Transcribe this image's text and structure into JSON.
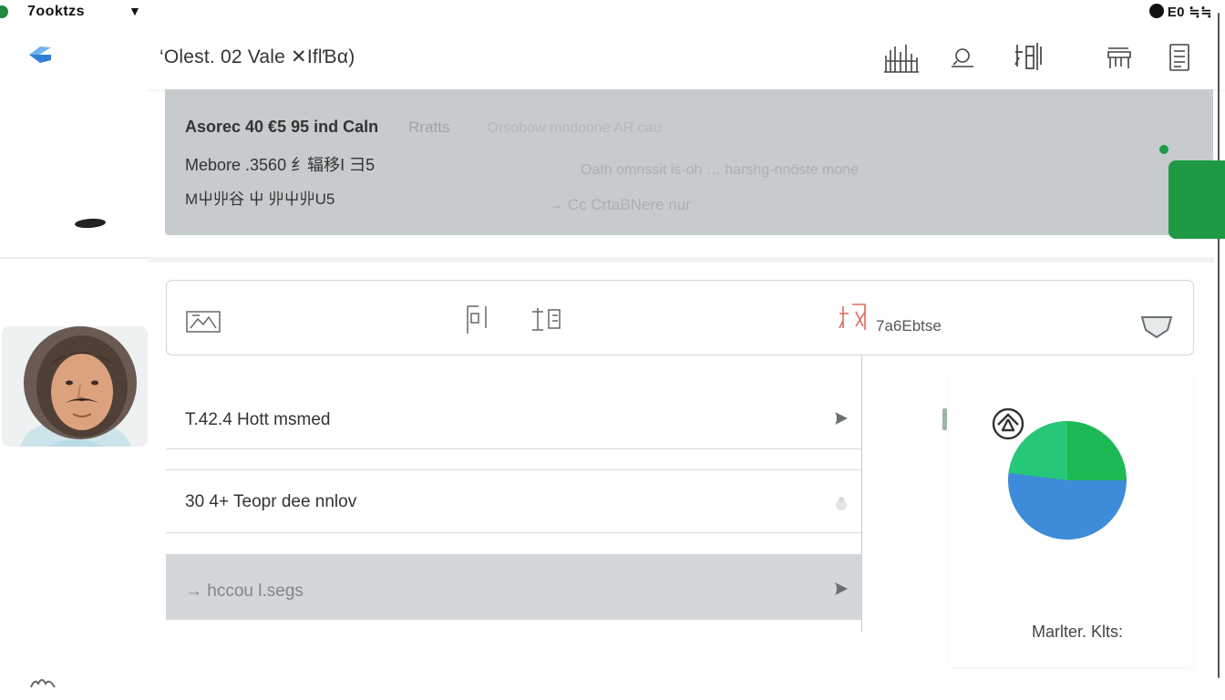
{
  "status_bar": {
    "app_name": "7ooktzs",
    "right_text": "E0 ≒≒"
  },
  "header": {
    "title": "‘Olest. 02 Vale ✕IflƁα)"
  },
  "summary": {
    "line1_bold": "Asorec 40 €5 95 ind Caln",
    "line1_faded": "Rratts",
    "line1_faded2": "Orsobow mndoone AR cau",
    "line2": "Mebore .3560 纟辐移I 彐5",
    "line2_faded": "Oath omnssit is-oh … harshg-nnöste mone",
    "line3": "Μ屮丱谷 屮 丱屮丱U5",
    "line3_faded": "→ Cc CrtaBNere nur"
  },
  "toolbar": {
    "status_text": "7a6Ebtse"
  },
  "list": {
    "rows": [
      {
        "label": "T.42.4 Hott msmed"
      },
      {
        "label": "30  4+ Teopr dee nnlov"
      },
      {
        "label": "→  hccou l.segs"
      }
    ]
  },
  "chart_data": {
    "type": "pie",
    "categories": [
      "",
      "",
      ""
    ],
    "values": [
      25,
      61,
      14
    ],
    "colors": [
      "#1db954",
      "#3d8bd9",
      "#f0a030"
    ],
    "highlight_color": "#27c77a",
    "caption": "Marlter. Klts:"
  },
  "colors": {
    "accent_green": "#1e9a44",
    "banner_grey": "#c6cccd",
    "selected_row": "#d3d7da",
    "back_blue": "#3a8fe0"
  }
}
